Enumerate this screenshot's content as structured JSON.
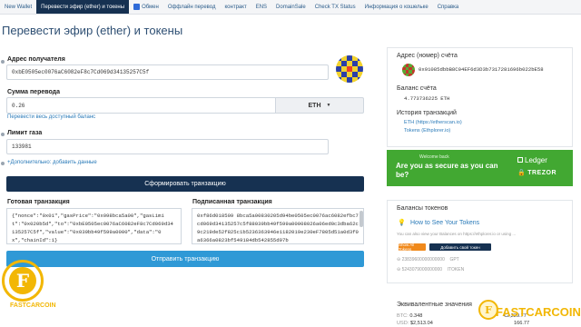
{
  "nav": {
    "tabs": [
      {
        "label": "New Wallet"
      },
      {
        "label": "Перевести эфир (ether) и токены"
      },
      {
        "label": "Обмен"
      },
      {
        "label": "Оффлайн перевод"
      },
      {
        "label": "контракт"
      },
      {
        "label": "ENS"
      },
      {
        "label": "DomainSale"
      },
      {
        "label": "Check TX Status"
      },
      {
        "label": "Информация о кошельке"
      },
      {
        "label": "Справка"
      }
    ]
  },
  "page": {
    "title": "Перевести эфир (ether) и токены"
  },
  "form": {
    "to_label": "Адрес получателя",
    "to_value": "0xbE0505ec0076aC6082eF8c7Cd069d34135257C5f",
    "amount_label": "Сумма перевода",
    "amount_value": "0.26",
    "unit": "ETH",
    "send_all_link": "Перевести весь доступный баланс",
    "gas_label": "Лимит газа",
    "gas_value": "133981",
    "advanced_link": "+Дополнительно: добавить данные",
    "generate_button": "Сформировать транзакцию",
    "raw_label": "Готовая транзакция",
    "raw_value": "{\"nonce\":\"0x01\",\"gasPrice\":\"0x098bca5a00\",\"gasLimit\":\"0x020b5d\",\"to\":\"0xbE0505ec0076aC6082eF8c7Cd069d34135257C5f\",\"value\":\"0x039bb49f599a0000\",\"data\":\"0x\",\"chainId\":1}",
    "signed_label": "Подписанная транзакция",
    "signed_value": "0xf86d018509 8bca5a00830205d94be0505ec0076ac6082efbc7cd069d34135257c5f88039bb49f599a00008026a06ed0c3dba62c9c219de52f825c1b5236363946e1182019e230eF7805d51a0d3f0a6366a0823bf549184db542855d97b",
    "send_button": "Отправить транзакцию"
  },
  "account": {
    "address_label": "Адрес (номер) счёта",
    "address_value": "0x91085dbbB8C04EF6d3D3b7317281696b022bE58",
    "balance_label": "Баланс счёта",
    "balance_value": "4.773736225 ETH",
    "history_label": "История транзакций",
    "history_eth": "ETH (https://etherscan.io)",
    "history_tokens": "Tokens (Ethplorer.io)"
  },
  "promo": {
    "welcome": "Welcome back",
    "headline": "Are you as secure as you can be?",
    "ledger": "Ledger",
    "trezor": "TREZOR"
  },
  "tokens": {
    "title": "Балансы токенов",
    "howto_link": "How to See Your Tokens",
    "desc": "You can also view your Balances on https://ethplorer.io or using ...",
    "show_all": "Show All Tokens",
    "add_custom": "Добавить свой токен",
    "rows": [
      {
        "value": "23839600000000000",
        "symbol": "GPT"
      },
      {
        "value": "5243079000000000",
        "symbol": "ITOKEN"
      }
    ]
  },
  "equiv": {
    "title": "Эквивалентные значения",
    "btc_label": "BTC:",
    "btc_value": "0.348",
    "usd_label": "USD:",
    "usd_value": "$2,513.04",
    "eur_value": "€2,229.77",
    "eur_value2": "166.77"
  },
  "watermark": {
    "brand": "FASTCARCOIN",
    "coin_glyph": "F"
  },
  "colors": {
    "nav_active": "#163151",
    "primary_dark": "#163151",
    "primary_blue": "#2f99d6",
    "promo_green": "#42a832",
    "link": "#2b7bb9",
    "watermark": "#f2b705"
  }
}
